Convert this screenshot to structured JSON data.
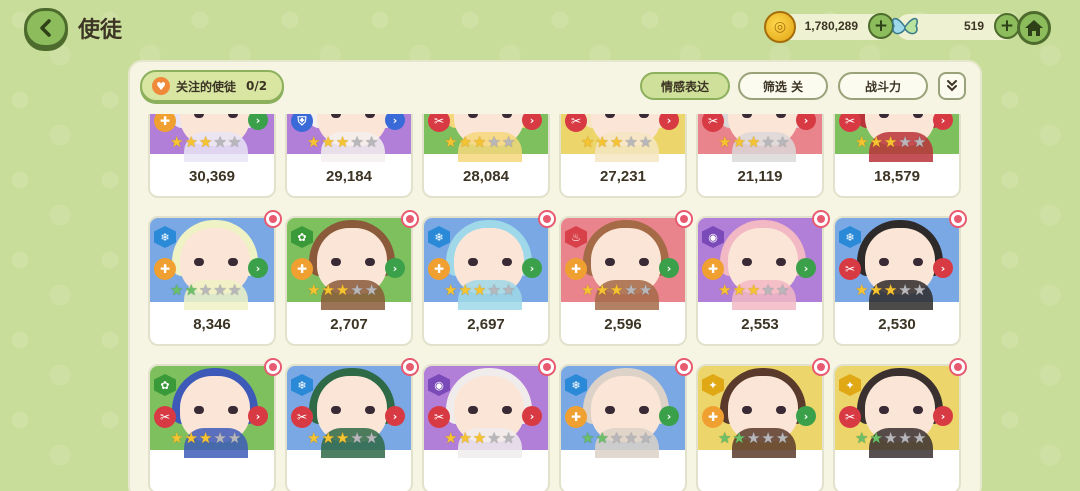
{
  "header": {
    "title": "使徒",
    "gold": "1,780,289",
    "gems": "519"
  },
  "toolbar": {
    "favorites_label": "关注的使徒",
    "favorites_count": "0/2",
    "emotion_label": "情感表达",
    "filter_label": "筛选 关",
    "power_label": "战斗力"
  },
  "colors": {
    "accent": "#8cbc5c",
    "panel": "#f6f5e4",
    "background": "#c9dd9a"
  },
  "cards": [
    {
      "power": "30,369",
      "bg": "purple",
      "hair": "#e8e4f6",
      "element": "psy",
      "role": "support",
      "stars": 3,
      "star_color": "gold"
    },
    {
      "power": "29,184",
      "bg": "purple",
      "hair": "#f3f0ee",
      "element": "psy",
      "role": "defender",
      "stars": 3,
      "star_color": "gold"
    },
    {
      "power": "28,084",
      "bg": "green",
      "hair": "#f6d77c",
      "element": "nature",
      "role": "striker",
      "stars": 3,
      "star_color": "gold"
    },
    {
      "power": "27,231",
      "bg": "yellow",
      "hair": "#f5e6c2",
      "element": "light",
      "role": "striker",
      "stars": 3,
      "star_color": "gold"
    },
    {
      "power": "21,119",
      "bg": "red",
      "hair": "#dcd8d8",
      "element": "fire",
      "role": "striker",
      "stars": 3,
      "star_color": "gold"
    },
    {
      "power": "18,579",
      "bg": "green",
      "hair": "#b8333a",
      "element": "nature",
      "role": "striker",
      "stars": 3,
      "star_color": "gold"
    },
    {
      "power": "8,346",
      "bg": "blue",
      "hair": "#eef2c4",
      "element": "ice",
      "role": "support",
      "stars": 2,
      "star_color": "green"
    },
    {
      "power": "2,707",
      "bg": "green",
      "hair": "#8a5a3a",
      "element": "nature",
      "role": "support",
      "stars": 3,
      "star_color": "gold"
    },
    {
      "power": "2,697",
      "bg": "blue",
      "hair": "#9fd8e8",
      "element": "ice",
      "role": "support",
      "stars": 3,
      "star_color": "gold"
    },
    {
      "power": "2,596",
      "bg": "red",
      "hair": "#a56a46",
      "element": "fire",
      "role": "support",
      "stars": 3,
      "star_color": "gold"
    },
    {
      "power": "2,553",
      "bg": "purple",
      "hair": "#f2b8c4",
      "element": "psy",
      "role": "support",
      "stars": 3,
      "star_color": "gold"
    },
    {
      "power": "2,530",
      "bg": "blue",
      "hair": "#2e2a2a",
      "element": "ice",
      "role": "striker",
      "stars": 3,
      "star_color": "gold"
    },
    {
      "power": "",
      "bg": "green",
      "hair": "#3d5ab8",
      "element": "nature",
      "role": "striker",
      "stars": 3,
      "star_color": "gold"
    },
    {
      "power": "",
      "bg": "blue",
      "hair": "#2e6a46",
      "element": "ice",
      "role": "striker",
      "stars": 3,
      "star_color": "gold"
    },
    {
      "power": "",
      "bg": "purple",
      "hair": "#f0ecec",
      "element": "psy",
      "role": "striker",
      "stars": 3,
      "star_color": "gold"
    },
    {
      "power": "",
      "bg": "blue",
      "hair": "#dcd2c8",
      "element": "ice",
      "role": "support",
      "stars": 2,
      "star_color": "green"
    },
    {
      "power": "",
      "bg": "yellow",
      "hair": "#5a3a2a",
      "element": "light",
      "role": "support",
      "stars": 2,
      "star_color": "green"
    },
    {
      "power": "",
      "bg": "yellow",
      "hair": "#3a3030",
      "element": "light",
      "role": "striker",
      "stars": 2,
      "star_color": "green"
    }
  ]
}
